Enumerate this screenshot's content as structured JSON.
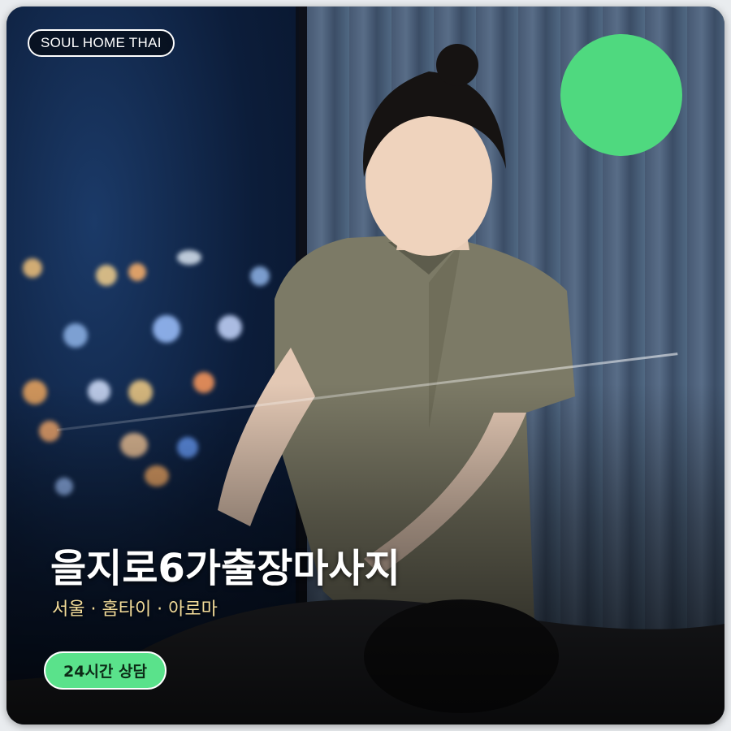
{
  "brand": {
    "label": "SOUL HOME THAI"
  },
  "hero": {
    "title": "을지로6가출장마사지",
    "subtitle": "서울 · 홈타이 · 아로마"
  },
  "cta": {
    "label": "24시간 상담"
  },
  "colors": {
    "accent_green": "#5ae28b",
    "dot_green": "#4fd97f",
    "subtitle_gold": "#f4dd9a",
    "uniform": "#7c7a66"
  },
  "image": {
    "subject": "massage-therapist-photo"
  }
}
